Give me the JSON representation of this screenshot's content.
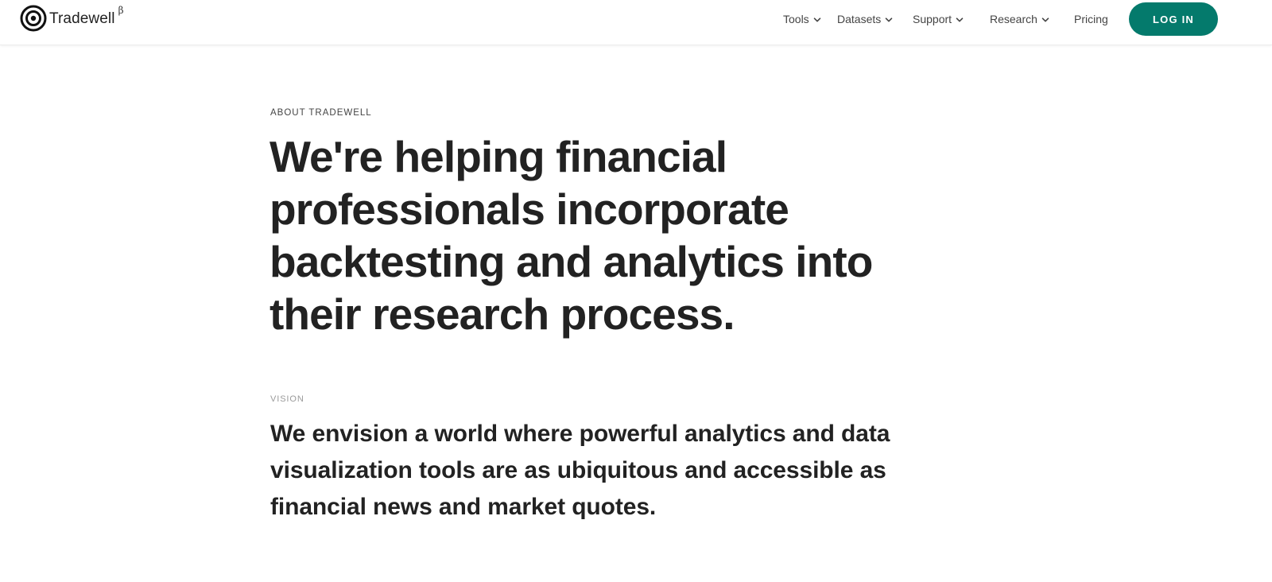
{
  "brand": {
    "name": "Tradewell",
    "superscript": "β",
    "logo_icon": "target-icon"
  },
  "nav": {
    "items": [
      {
        "label": "Tools",
        "icon": "chevron-down-icon"
      },
      {
        "label": "Datasets",
        "icon": "chevron-down-icon"
      },
      {
        "label": "Support",
        "icon": "chevron-down-icon"
      },
      {
        "label": "Research",
        "icon": "chevron-down-icon"
      },
      {
        "label": "Pricing"
      }
    ],
    "login_label": "LOG IN"
  },
  "about": {
    "eyebrow": "ABOUT TRADEWELL",
    "headline": "We're helping financial professionals incorporate backtesting and analytics into their research process."
  },
  "vision": {
    "label": "VISION",
    "text": "We envision a world where powerful analytics and data visualization tools are as ubiquitous and accessible as financial news and market quotes."
  },
  "colors": {
    "accent": "#047a6c",
    "text": "#222222",
    "muted": "#9a9a9a"
  }
}
